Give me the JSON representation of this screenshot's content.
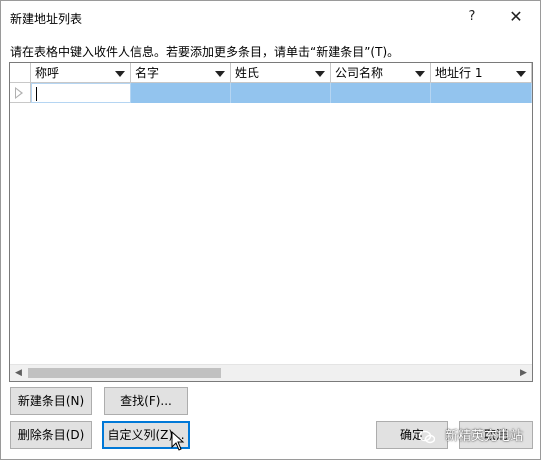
{
  "window": {
    "title": "新建地址列表",
    "help_label": "?",
    "close_label": "✕"
  },
  "instruction": "请在表格中键入收件人信息。若要添加更多条目，请单击“新建条目”(T)。",
  "grid": {
    "columns": [
      {
        "label": "称呼"
      },
      {
        "label": "名字"
      },
      {
        "label": "姓氏"
      },
      {
        "label": "公司名称"
      },
      {
        "label": "地址行 1"
      }
    ],
    "rows": [
      {
        "cells": [
          "",
          "",
          "",
          "",
          ""
        ]
      }
    ]
  },
  "buttons": {
    "new_entry": "新建条目(N)",
    "find": "查找(F)...",
    "delete_entry": "删除条目(D)",
    "customize_columns": "自定义列(Z)...",
    "ok": "确定",
    "cancel": "取消"
  },
  "watermark": "新精英充电站",
  "colors": {
    "selected_row": "#93c4ee",
    "focus_border": "#0078d7",
    "button_bg": "#e1e1e1"
  }
}
